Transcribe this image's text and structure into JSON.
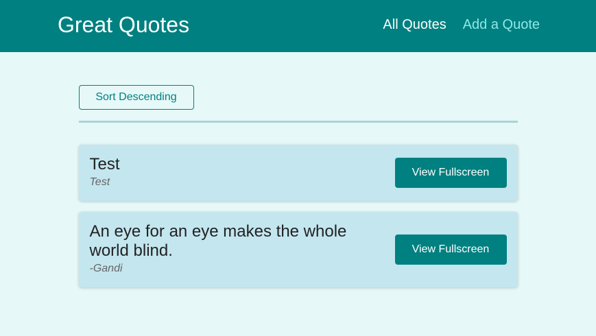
{
  "header": {
    "logo": "Great Quotes",
    "nav": {
      "all_quotes": "All Quotes",
      "add_quote": "Add a Quote"
    }
  },
  "toolbar": {
    "sort_label": "Sort Descending"
  },
  "quotes": [
    {
      "text": "Test",
      "author": "Test",
      "button_label": "View Fullscreen"
    },
    {
      "text": "An eye for an eye makes the whole world blind.",
      "author": "-Gandi",
      "button_label": "View Fullscreen"
    }
  ],
  "colors": {
    "primary": "#008080",
    "background": "#e6f8f8",
    "card": "#c3e6ef",
    "nav_active": "#8ee8e8"
  }
}
